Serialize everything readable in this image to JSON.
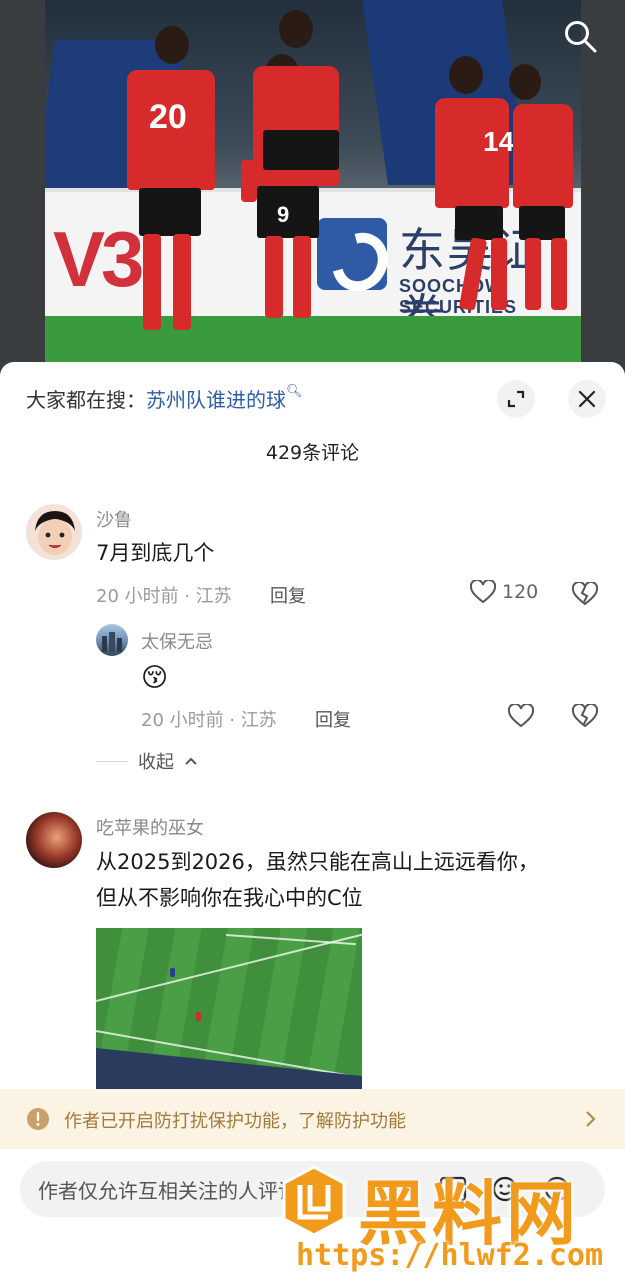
{
  "search_bar": {
    "prefix": "大家都在搜：",
    "keyword": "苏州队谁进的球"
  },
  "comments_count": "429条评论",
  "comments": [
    {
      "name": "沙鲁",
      "text": "7月到底几个",
      "meta": "20 小时前 · 江苏",
      "reply_label": "回复",
      "likes": "120"
    },
    {
      "name": "太保无忌",
      "text": "😚",
      "meta": "20 小时前 · 江苏",
      "reply_label": "回复",
      "likes": ""
    },
    {
      "name": "吃苹果的巫女",
      "text_line1": "从2025到2026，虽然只能在高山上远远看你，",
      "text_line2": "但从不影响你在我心中的C位"
    }
  ],
  "collapse_label": "收起",
  "notice": {
    "text": "作者已开启防打扰保护功能，了解防护功能"
  },
  "input": {
    "placeholder": "作者仅允许互相关注的人评论"
  },
  "video": {
    "billboard_brand": "V3",
    "billboard_cn": "东吴证券",
    "billboard_en": "SOOCHOW SECURITIES",
    "jersey_numbers": [
      "20",
      "9",
      "14"
    ]
  },
  "watermark": {
    "title": "黑料网",
    "url": "https://hlwf2.com"
  },
  "colors": {
    "keyword": "#2f5ea8",
    "notice_bg": "#fbf3e4",
    "notice_text": "#a47a3a",
    "jersey": "#d72a2a",
    "watermark": "#f29a1c"
  },
  "icons": [
    "search-icon",
    "expand-icon",
    "close-icon",
    "heart-icon",
    "broken-heart-icon",
    "chevron-up-icon",
    "warning-icon",
    "chevron-right-icon",
    "image-icon",
    "emoji-icon",
    "at-icon"
  ]
}
